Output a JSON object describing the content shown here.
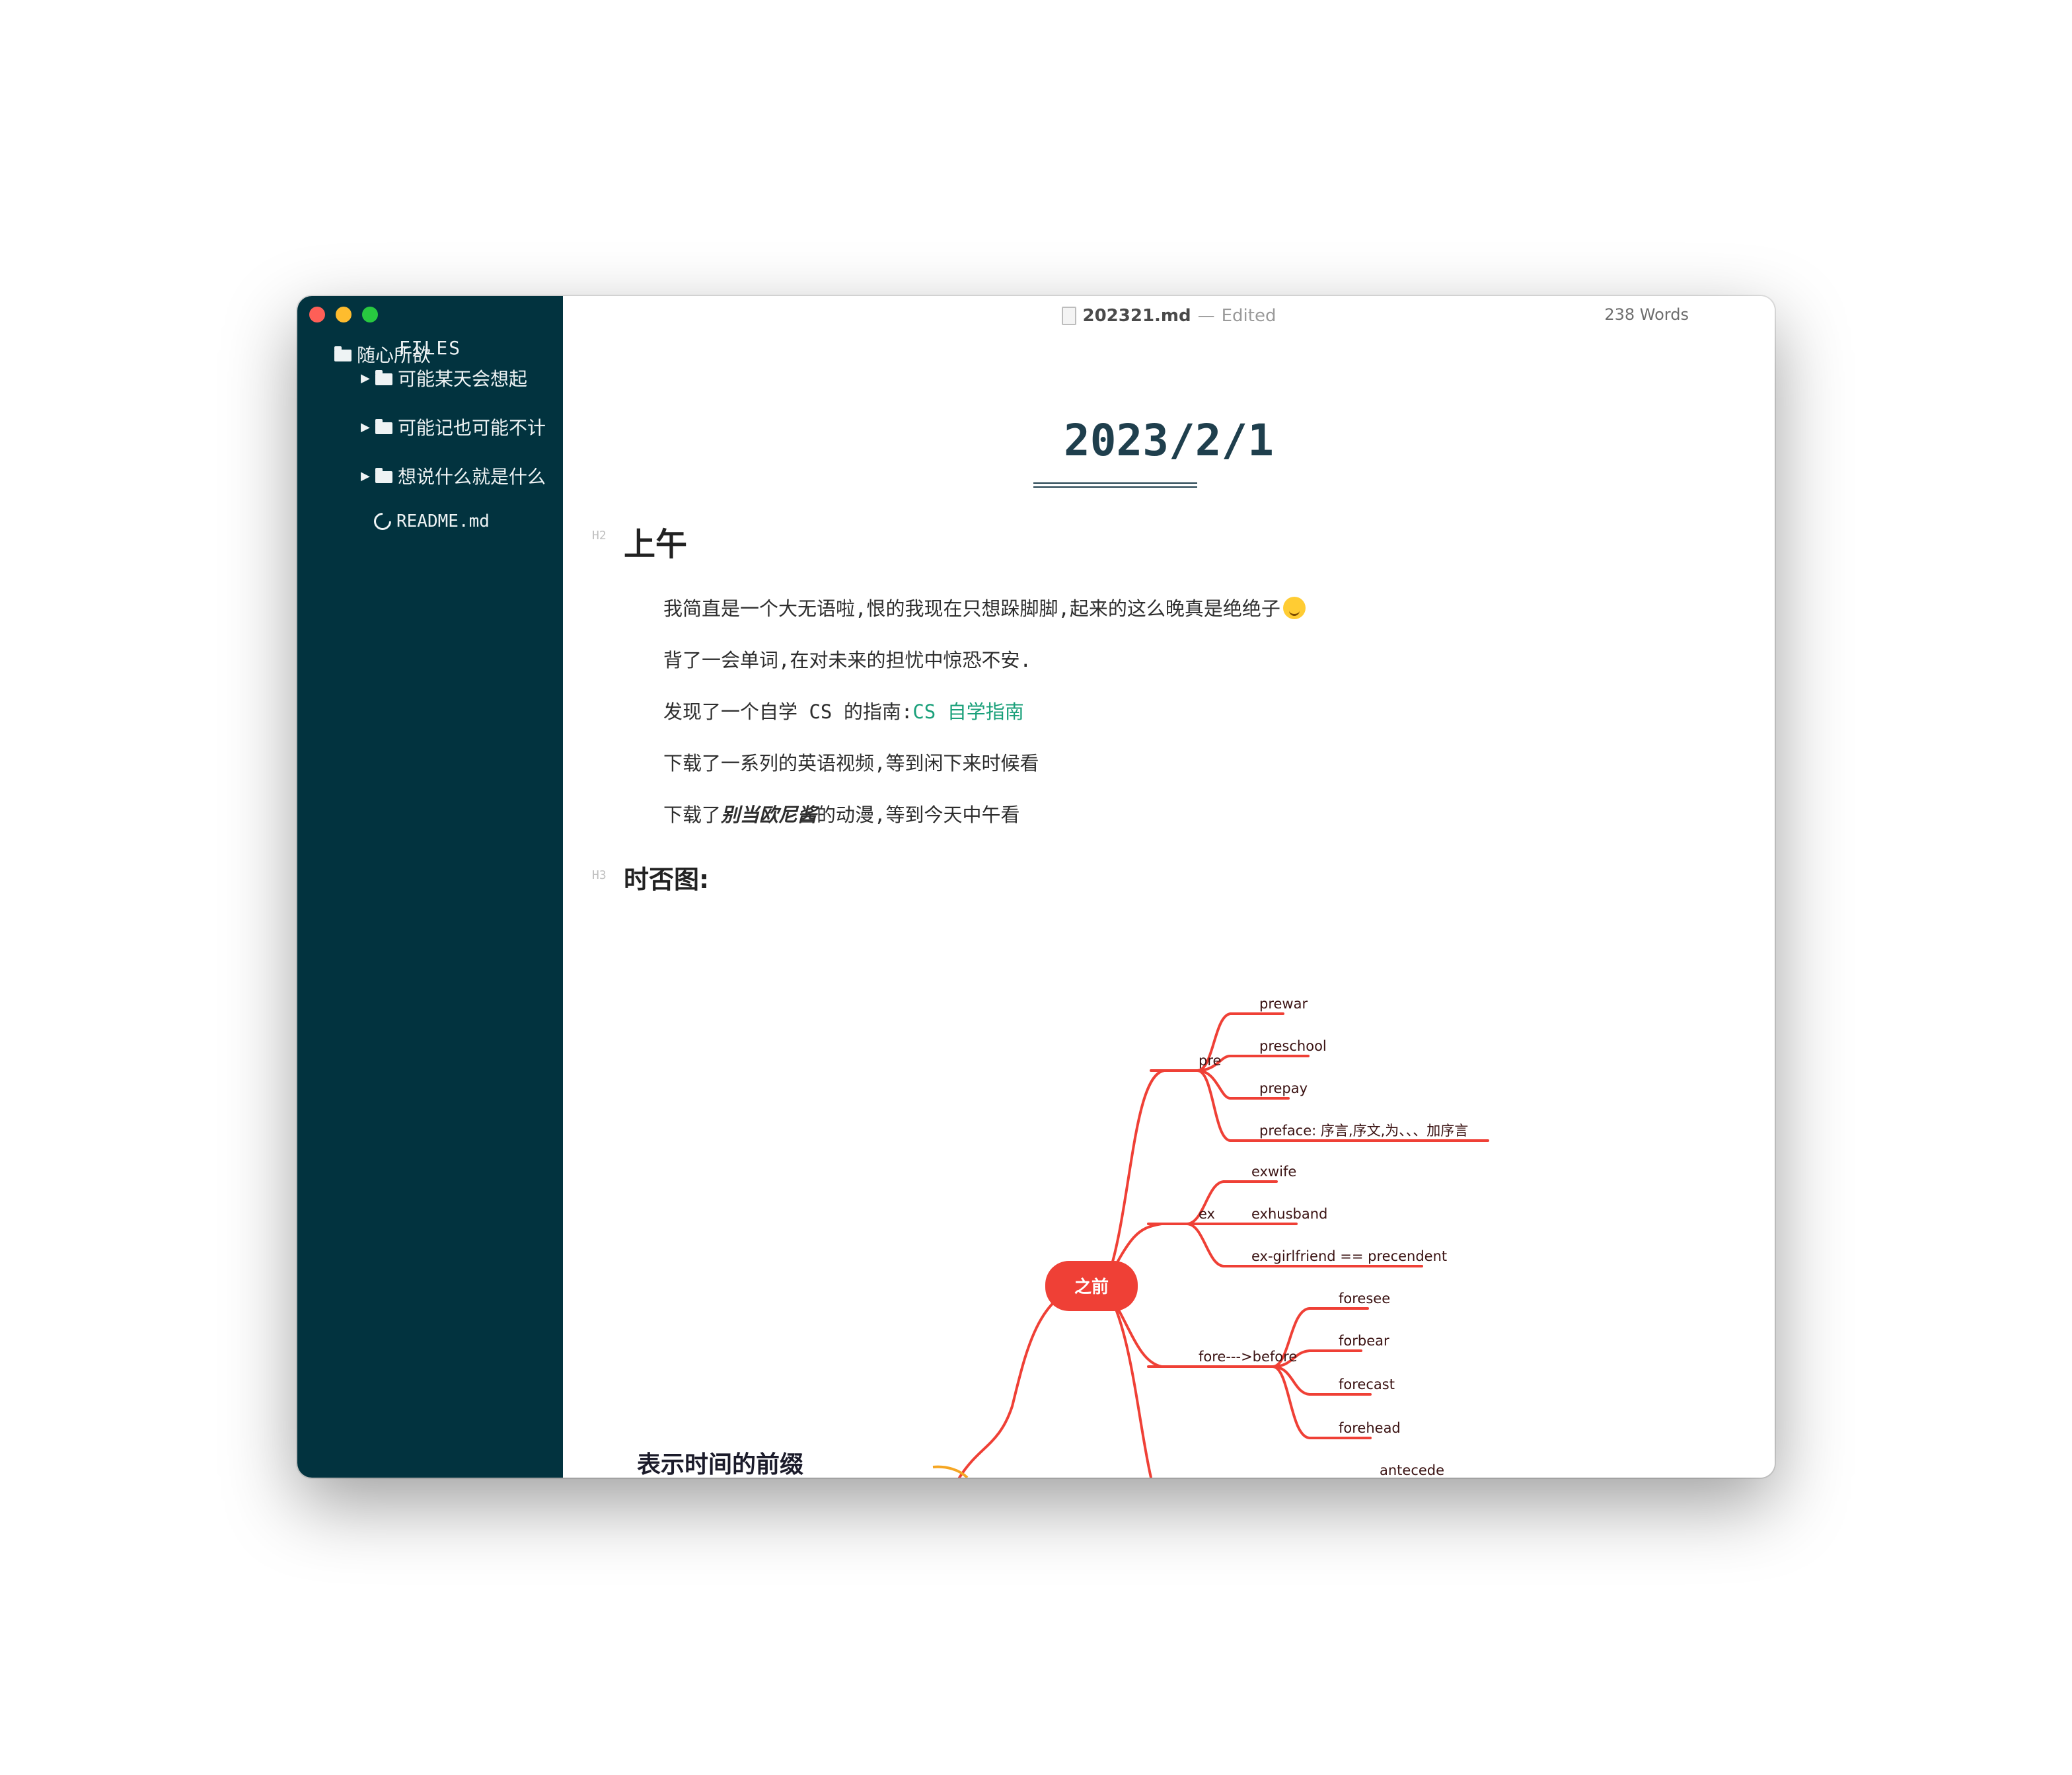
{
  "window": {
    "file_name": "202321.md",
    "separator": "—",
    "status": "Edited",
    "word_count": "238 Words"
  },
  "sidebar": {
    "title": "FILES",
    "root_folder": "随心所欲",
    "items": [
      {
        "label": "可能某天会想起",
        "type": "folder"
      },
      {
        "label": "可能记也可能不计",
        "type": "folder"
      },
      {
        "label": "想说什么就是什么",
        "type": "folder"
      },
      {
        "label": "README.md",
        "type": "file"
      }
    ]
  },
  "document": {
    "title": "2023/2/1",
    "h2_marker": "H2",
    "h2": "上午",
    "paragraphs": {
      "p1": "我简直是一个大无语啦,恨的我现在只想跺脚脚,起来的这么晚真是绝绝子",
      "p2": "背了一会单词,在对未来的担忧中惊恐不安.",
      "p3_prefix": "发现了一个自学 CS 的指南:",
      "p3_link": "CS 自学指南",
      "p4": "下载了一系列的英语视频,等到闲下来时候看",
      "p5_prefix": "下载了",
      "p5_emphasis": "别当欧尼酱",
      "p5_suffix": "的动漫,等到今天中午看"
    },
    "h3_marker": "H3",
    "h3": "时否图:"
  },
  "mindmap": {
    "root": "表示时间的前缀",
    "center": "之前",
    "branches": {
      "pre": {
        "label": "pre",
        "children": [
          "prewar",
          "preschool",
          "prepay",
          "preface: 序言,序文,为、、、加序言"
        ]
      },
      "ex": {
        "label": "ex",
        "children": [
          "exwife",
          "exhusband",
          "ex-girlfriend == precendent"
        ]
      },
      "fore": {
        "label": "fore--->before",
        "children": [
          "foresee",
          "forbear",
          "forecast",
          "forehead"
        ]
      },
      "ante": {
        "children": [
          "antecede"
        ]
      }
    },
    "colors": {
      "branch": "#ef4036",
      "center_fill": "#ef4036",
      "root_connector": "#f5a623"
    }
  },
  "icons": {
    "folder": "folder-icon",
    "file": "circle-icon",
    "caret": "caret-right-icon",
    "doc": "document-icon",
    "emoji": "smiley-tongue-emoji"
  }
}
